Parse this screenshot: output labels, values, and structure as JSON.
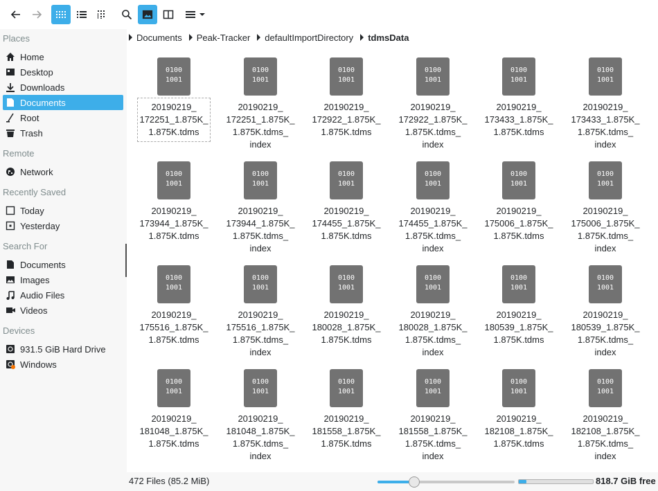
{
  "toolbar": {
    "back_icon": "arrow-left-icon",
    "forward_icon": "arrow-right-icon",
    "view_modes": [
      "icons-view",
      "compact-view",
      "details-view"
    ],
    "active_view": "icons-view",
    "search_icon": "search-icon",
    "preview_icon": "image-preview-icon",
    "split_icon": "split-view-icon",
    "menu_icon": "hamburger-menu-icon",
    "accent": "#3daee9"
  },
  "sidebar": {
    "sections": [
      {
        "title": "Places",
        "items": [
          {
            "label": "Home",
            "icon": "home-icon"
          },
          {
            "label": "Desktop",
            "icon": "desktop-icon"
          },
          {
            "label": "Downloads",
            "icon": "download-icon"
          },
          {
            "label": "Documents",
            "icon": "document-icon",
            "selected": true
          },
          {
            "label": "Root",
            "icon": "root-icon"
          },
          {
            "label": "Trash",
            "icon": "trash-icon"
          }
        ]
      },
      {
        "title": "Remote",
        "items": [
          {
            "label": "Network",
            "icon": "network-icon"
          }
        ]
      },
      {
        "title": "Recently Saved",
        "items": [
          {
            "label": "Today",
            "icon": "calendar-today-icon"
          },
          {
            "label": "Yesterday",
            "icon": "calendar-yesterday-icon"
          }
        ]
      },
      {
        "title": "Search For",
        "items": [
          {
            "label": "Documents",
            "icon": "document-icon"
          },
          {
            "label": "Images",
            "icon": "image-icon"
          },
          {
            "label": "Audio Files",
            "icon": "music-icon"
          },
          {
            "label": "Videos",
            "icon": "video-icon"
          }
        ]
      },
      {
        "title": "Devices",
        "items": [
          {
            "label": "931.5 GiB Hard Drive",
            "icon": "hard-drive-icon"
          },
          {
            "label": "Windows",
            "icon": "windows-drive-icon"
          }
        ]
      }
    ]
  },
  "breadcrumb": [
    "Documents",
    "Peak-Tracker",
    "defaultImportDirectory",
    "tdmsData"
  ],
  "file_icon_text": "0100\n1001",
  "files": [
    "20190219_\n172251_1.875K_\n1.875K.tdms",
    "20190219_\n172251_1.875K_\n1.875K.tdms_\nindex",
    "20190219_\n172922_1.875K_\n1.875K.tdms",
    "20190219_\n172922_1.875K_\n1.875K.tdms_\nindex",
    "20190219_\n173433_1.875K_\n1.875K.tdms",
    "20190219_\n173433_1.875K_\n1.875K.tdms_\nindex",
    "20190219_\n173944_1.875K_\n1.875K.tdms",
    "20190219_\n173944_1.875K_\n1.875K.tdms_\nindex",
    "20190219_\n174455_1.875K_\n1.875K.tdms",
    "20190219_\n174455_1.875K_\n1.875K.tdms_\nindex",
    "20190219_\n175006_1.875K_\n1.875K.tdms",
    "20190219_\n175006_1.875K_\n1.875K.tdms_\nindex",
    "20190219_\n175516_1.875K_\n1.875K.tdms",
    "20190219_\n175516_1.875K_\n1.875K.tdms_\nindex",
    "20190219_\n180028_1.875K_\n1.875K.tdms",
    "20190219_\n180028_1.875K_\n1.875K.tdms_\nindex",
    "20190219_\n180539_1.875K_\n1.875K.tdms",
    "20190219_\n180539_1.875K_\n1.875K.tdms_\nindex",
    "20190219_\n181048_1.875K_\n1.875K.tdms",
    "20190219_\n181048_1.875K_\n1.875K.tdms_\nindex",
    "20190219_\n181558_1.875K_\n1.875K.tdms",
    "20190219_\n181558_1.875K_\n1.875K.tdms_\nindex",
    "20190219_\n182108_1.875K_\n1.875K.tdms",
    "20190219_\n182108_1.875K_\n1.875K.tdms_\nindex"
  ],
  "status": {
    "file_count": "472 Files (85.2 MiB)",
    "zoom_fraction": 0.27,
    "space_used_fraction": 0.1,
    "free_space": "818.7 GiB free"
  }
}
